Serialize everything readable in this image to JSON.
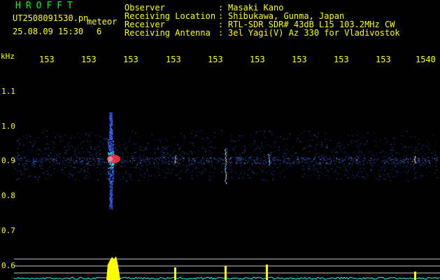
{
  "brand": "HROFFT",
  "filename": "UT2508091530.pn",
  "meteor_tag": "meteor",
  "datetime": "25.08.09 15:30",
  "count": "6",
  "header": {
    "rows": [
      {
        "label": "Observer",
        "value": "Masaki Kano"
      },
      {
        "label": "Receiving Location",
        "value": "Shibukawa, Gunma, Japan"
      },
      {
        "label": "Receiver",
        "value": "RTL-SDR SDR# 43dB L15 103.2MHz CW"
      },
      {
        "label": "Receiving Antenna",
        "value": "3el Yagi(V) Az 330 for Vladivostok"
      }
    ]
  },
  "axes": {
    "y_unit": "kHz",
    "x_ticks": [
      "153",
      "153",
      "153",
      "153",
      "153",
      "153",
      "153",
      "153",
      "153",
      "1540"
    ],
    "y_ticks": [
      "1.1",
      "1.0",
      "0.9",
      "0.8",
      "0.7",
      "0.6"
    ]
  },
  "colors": {
    "text": "#ffff00",
    "brand": "#00ff00",
    "noise": "#1a2a8a",
    "signal": "#ff3050",
    "power": "#00ffff"
  }
}
